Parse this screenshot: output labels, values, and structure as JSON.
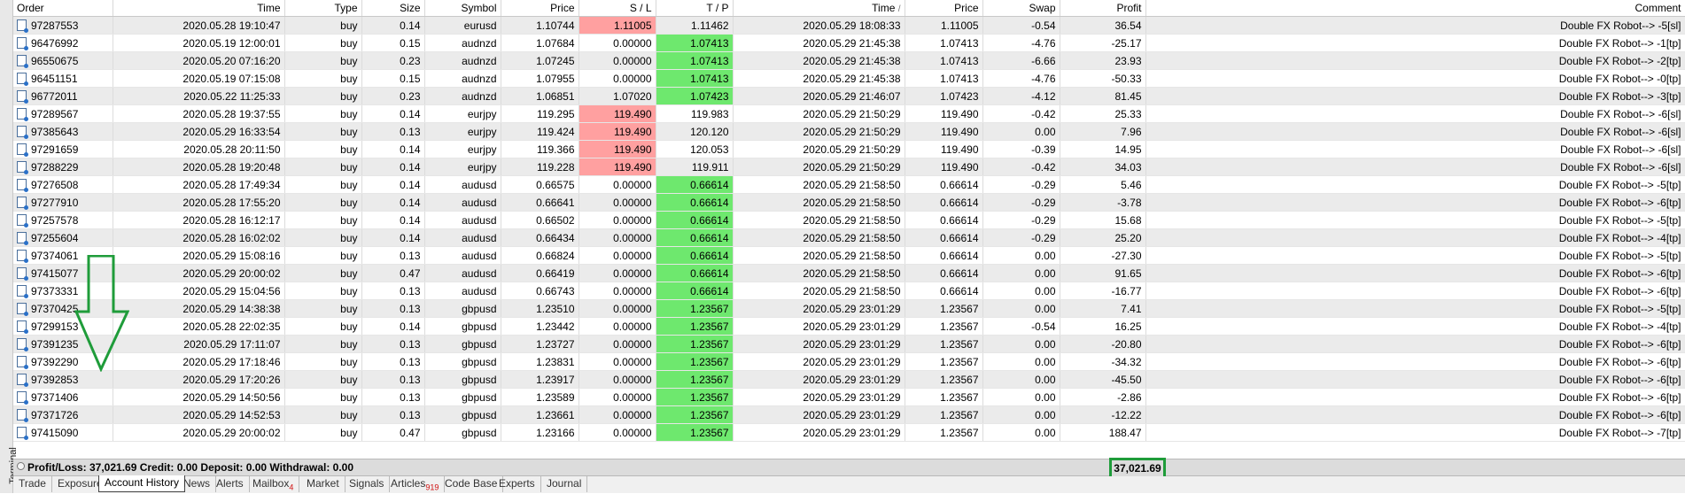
{
  "panel": {
    "side_label": "Terminal"
  },
  "columns": [
    "Order",
    "Time",
    "Type",
    "Size",
    "Symbol",
    "Price",
    "S / L",
    "T / P",
    "Time",
    "Price",
    "Swap",
    "Profit",
    "Comment"
  ],
  "sort_indicator": "/",
  "rows": [
    {
      "order": "97287553",
      "time": "2020.05.28 19:10:47",
      "type": "buy",
      "size": "0.14",
      "symbol": "eurusd",
      "price": "1.10744",
      "sl": "1.11005",
      "tp": "1.11462",
      "close_time": "2020.05.29 18:08:33",
      "close_price": "1.11005",
      "swap": "-0.54",
      "profit": "36.54",
      "comment": "Double FX Robot--> -5[sl]",
      "sl_hl": "red",
      "tp_hl": ""
    },
    {
      "order": "96476992",
      "time": "2020.05.19 12:00:01",
      "type": "buy",
      "size": "0.15",
      "symbol": "audnzd",
      "price": "1.07684",
      "sl": "0.00000",
      "tp": "1.07413",
      "close_time": "2020.05.29 21:45:38",
      "close_price": "1.07413",
      "swap": "-4.76",
      "profit": "-25.17",
      "comment": "Double FX Robot--> -1[tp]",
      "sl_hl": "",
      "tp_hl": "green"
    },
    {
      "order": "96550675",
      "time": "2020.05.20 07:16:20",
      "type": "buy",
      "size": "0.23",
      "symbol": "audnzd",
      "price": "1.07245",
      "sl": "0.00000",
      "tp": "1.07413",
      "close_time": "2020.05.29 21:45:38",
      "close_price": "1.07413",
      "swap": "-6.66",
      "profit": "23.93",
      "comment": "Double FX Robot--> -2[tp]",
      "sl_hl": "",
      "tp_hl": "green"
    },
    {
      "order": "96451151",
      "time": "2020.05.19 07:15:08",
      "type": "buy",
      "size": "0.15",
      "symbol": "audnzd",
      "price": "1.07955",
      "sl": "0.00000",
      "tp": "1.07413",
      "close_time": "2020.05.29 21:45:38",
      "close_price": "1.07413",
      "swap": "-4.76",
      "profit": "-50.33",
      "comment": "Double FX Robot--> -0[tp]",
      "sl_hl": "",
      "tp_hl": "green"
    },
    {
      "order": "96772011",
      "time": "2020.05.22 11:25:33",
      "type": "buy",
      "size": "0.23",
      "symbol": "audnzd",
      "price": "1.06851",
      "sl": "1.07020",
      "tp": "1.07423",
      "close_time": "2020.05.29 21:46:07",
      "close_price": "1.07423",
      "swap": "-4.12",
      "profit": "81.45",
      "comment": "Double FX Robot--> -3[tp]",
      "sl_hl": "",
      "tp_hl": "green"
    },
    {
      "order": "97289567",
      "time": "2020.05.28 19:37:55",
      "type": "buy",
      "size": "0.14",
      "symbol": "eurjpy",
      "price": "119.295",
      "sl": "119.490",
      "tp": "119.983",
      "close_time": "2020.05.29 21:50:29",
      "close_price": "119.490",
      "swap": "-0.42",
      "profit": "25.33",
      "comment": "Double FX Robot--> -6[sl]",
      "sl_hl": "red",
      "tp_hl": ""
    },
    {
      "order": "97385643",
      "time": "2020.05.29 16:33:54",
      "type": "buy",
      "size": "0.13",
      "symbol": "eurjpy",
      "price": "119.424",
      "sl": "119.490",
      "tp": "120.120",
      "close_time": "2020.05.29 21:50:29",
      "close_price": "119.490",
      "swap": "0.00",
      "profit": "7.96",
      "comment": "Double FX Robot--> -6[sl]",
      "sl_hl": "red",
      "tp_hl": ""
    },
    {
      "order": "97291659",
      "time": "2020.05.28 20:11:50",
      "type": "buy",
      "size": "0.14",
      "symbol": "eurjpy",
      "price": "119.366",
      "sl": "119.490",
      "tp": "120.053",
      "close_time": "2020.05.29 21:50:29",
      "close_price": "119.490",
      "swap": "-0.39",
      "profit": "14.95",
      "comment": "Double FX Robot--> -6[sl]",
      "sl_hl": "red",
      "tp_hl": ""
    },
    {
      "order": "97288229",
      "time": "2020.05.28 19:20:48",
      "type": "buy",
      "size": "0.14",
      "symbol": "eurjpy",
      "price": "119.228",
      "sl": "119.490",
      "tp": "119.911",
      "close_time": "2020.05.29 21:50:29",
      "close_price": "119.490",
      "swap": "-0.42",
      "profit": "34.03",
      "comment": "Double FX Robot--> -6[sl]",
      "sl_hl": "red",
      "tp_hl": ""
    },
    {
      "order": "97276508",
      "time": "2020.05.28 17:49:34",
      "type": "buy",
      "size": "0.14",
      "symbol": "audusd",
      "price": "0.66575",
      "sl": "0.00000",
      "tp": "0.66614",
      "close_time": "2020.05.29 21:58:50",
      "close_price": "0.66614",
      "swap": "-0.29",
      "profit": "5.46",
      "comment": "Double FX Robot--> -5[tp]",
      "sl_hl": "",
      "tp_hl": "green"
    },
    {
      "order": "97277910",
      "time": "2020.05.28 17:55:20",
      "type": "buy",
      "size": "0.14",
      "symbol": "audusd",
      "price": "0.66641",
      "sl": "0.00000",
      "tp": "0.66614",
      "close_time": "2020.05.29 21:58:50",
      "close_price": "0.66614",
      "swap": "-0.29",
      "profit": "-3.78",
      "comment": "Double FX Robot--> -6[tp]",
      "sl_hl": "",
      "tp_hl": "green"
    },
    {
      "order": "97257578",
      "time": "2020.05.28 16:12:17",
      "type": "buy",
      "size": "0.14",
      "symbol": "audusd",
      "price": "0.66502",
      "sl": "0.00000",
      "tp": "0.66614",
      "close_time": "2020.05.29 21:58:50",
      "close_price": "0.66614",
      "swap": "-0.29",
      "profit": "15.68",
      "comment": "Double FX Robot--> -5[tp]",
      "sl_hl": "",
      "tp_hl": "green"
    },
    {
      "order": "97255604",
      "time": "2020.05.28 16:02:02",
      "type": "buy",
      "size": "0.14",
      "symbol": "audusd",
      "price": "0.66434",
      "sl": "0.00000",
      "tp": "0.66614",
      "close_time": "2020.05.29 21:58:50",
      "close_price": "0.66614",
      "swap": "-0.29",
      "profit": "25.20",
      "comment": "Double FX Robot--> -4[tp]",
      "sl_hl": "",
      "tp_hl": "green"
    },
    {
      "order": "97374061",
      "time": "2020.05.29 15:08:16",
      "type": "buy",
      "size": "0.13",
      "symbol": "audusd",
      "price": "0.66824",
      "sl": "0.00000",
      "tp": "0.66614",
      "close_time": "2020.05.29 21:58:50",
      "close_price": "0.66614",
      "swap": "0.00",
      "profit": "-27.30",
      "comment": "Double FX Robot--> -5[tp]",
      "sl_hl": "",
      "tp_hl": "green"
    },
    {
      "order": "97415077",
      "time": "2020.05.29 20:00:02",
      "type": "buy",
      "size": "0.47",
      "symbol": "audusd",
      "price": "0.66419",
      "sl": "0.00000",
      "tp": "0.66614",
      "close_time": "2020.05.29 21:58:50",
      "close_price": "0.66614",
      "swap": "0.00",
      "profit": "91.65",
      "comment": "Double FX Robot--> -6[tp]",
      "sl_hl": "",
      "tp_hl": "green"
    },
    {
      "order": "97373331",
      "time": "2020.05.29 15:04:56",
      "type": "buy",
      "size": "0.13",
      "symbol": "audusd",
      "price": "0.66743",
      "sl": "0.00000",
      "tp": "0.66614",
      "close_time": "2020.05.29 21:58:50",
      "close_price": "0.66614",
      "swap": "0.00",
      "profit": "-16.77",
      "comment": "Double FX Robot--> -6[tp]",
      "sl_hl": "",
      "tp_hl": "green"
    },
    {
      "order": "97370425",
      "time": "2020.05.29 14:38:38",
      "type": "buy",
      "size": "0.13",
      "symbol": "gbpusd",
      "price": "1.23510",
      "sl": "0.00000",
      "tp": "1.23567",
      "close_time": "2020.05.29 23:01:29",
      "close_price": "1.23567",
      "swap": "0.00",
      "profit": "7.41",
      "comment": "Double FX Robot--> -5[tp]",
      "sl_hl": "",
      "tp_hl": "green"
    },
    {
      "order": "97299153",
      "time": "2020.05.28 22:02:35",
      "type": "buy",
      "size": "0.14",
      "symbol": "gbpusd",
      "price": "1.23442",
      "sl": "0.00000",
      "tp": "1.23567",
      "close_time": "2020.05.29 23:01:29",
      "close_price": "1.23567",
      "swap": "-0.54",
      "profit": "16.25",
      "comment": "Double FX Robot--> -4[tp]",
      "sl_hl": "",
      "tp_hl": "green"
    },
    {
      "order": "97391235",
      "time": "2020.05.29 17:11:07",
      "type": "buy",
      "size": "0.13",
      "symbol": "gbpusd",
      "price": "1.23727",
      "sl": "0.00000",
      "tp": "1.23567",
      "close_time": "2020.05.29 23:01:29",
      "close_price": "1.23567",
      "swap": "0.00",
      "profit": "-20.80",
      "comment": "Double FX Robot--> -6[tp]",
      "sl_hl": "",
      "tp_hl": "green"
    },
    {
      "order": "97392290",
      "time": "2020.05.29 17:18:46",
      "type": "buy",
      "size": "0.13",
      "symbol": "gbpusd",
      "price": "1.23831",
      "sl": "0.00000",
      "tp": "1.23567",
      "close_time": "2020.05.29 23:01:29",
      "close_price": "1.23567",
      "swap": "0.00",
      "profit": "-34.32",
      "comment": "Double FX Robot--> -6[tp]",
      "sl_hl": "",
      "tp_hl": "green"
    },
    {
      "order": "97392853",
      "time": "2020.05.29 17:20:26",
      "type": "buy",
      "size": "0.13",
      "symbol": "gbpusd",
      "price": "1.23917",
      "sl": "0.00000",
      "tp": "1.23567",
      "close_time": "2020.05.29 23:01:29",
      "close_price": "1.23567",
      "swap": "0.00",
      "profit": "-45.50",
      "comment": "Double FX Robot--> -6[tp]",
      "sl_hl": "",
      "tp_hl": "green"
    },
    {
      "order": "97371406",
      "time": "2020.05.29 14:50:56",
      "type": "buy",
      "size": "0.13",
      "symbol": "gbpusd",
      "price": "1.23589",
      "sl": "0.00000",
      "tp": "1.23567",
      "close_time": "2020.05.29 23:01:29",
      "close_price": "1.23567",
      "swap": "0.00",
      "profit": "-2.86",
      "comment": "Double FX Robot--> -6[tp]",
      "sl_hl": "",
      "tp_hl": "green"
    },
    {
      "order": "97371726",
      "time": "2020.05.29 14:52:53",
      "type": "buy",
      "size": "0.13",
      "symbol": "gbpusd",
      "price": "1.23661",
      "sl": "0.00000",
      "tp": "1.23567",
      "close_time": "2020.05.29 23:01:29",
      "close_price": "1.23567",
      "swap": "0.00",
      "profit": "-12.22",
      "comment": "Double FX Robot--> -6[tp]",
      "sl_hl": "",
      "tp_hl": "green"
    },
    {
      "order": "97415090",
      "time": "2020.05.29 20:00:02",
      "type": "buy",
      "size": "0.47",
      "symbol": "gbpusd",
      "price": "1.23166",
      "sl": "0.00000",
      "tp": "1.23567",
      "close_time": "2020.05.29 23:01:29",
      "close_price": "1.23567",
      "swap": "0.00",
      "profit": "188.47",
      "comment": "Double FX Robot--> -7[tp]",
      "sl_hl": "",
      "tp_hl": "green"
    }
  ],
  "summary": {
    "text": "Profit/Loss: 37,021.69  Credit: 0.00  Deposit: 0.00  Withdrawal: 0.00",
    "profit_total": "37,021.69"
  },
  "tabs": [
    {
      "label": "Trade",
      "badge": ""
    },
    {
      "label": "Exposure",
      "badge": ""
    },
    {
      "label": "Account History",
      "badge": "",
      "active": true
    },
    {
      "label": "News",
      "badge": ""
    },
    {
      "label": "Alerts",
      "badge": ""
    },
    {
      "label": "Mailbox",
      "badge": "4"
    },
    {
      "label": "Market",
      "badge": ""
    },
    {
      "label": "Signals",
      "badge": ""
    },
    {
      "label": "Articles",
      "badge": "919"
    },
    {
      "label": "Code Base",
      "badge": ""
    },
    {
      "label": "Experts",
      "badge": ""
    },
    {
      "label": "Journal",
      "badge": ""
    }
  ],
  "colors": {
    "sl_highlight": "#ffa0a0",
    "tp_highlight": "#6ee86e",
    "annotation": "#1f9c3a"
  }
}
